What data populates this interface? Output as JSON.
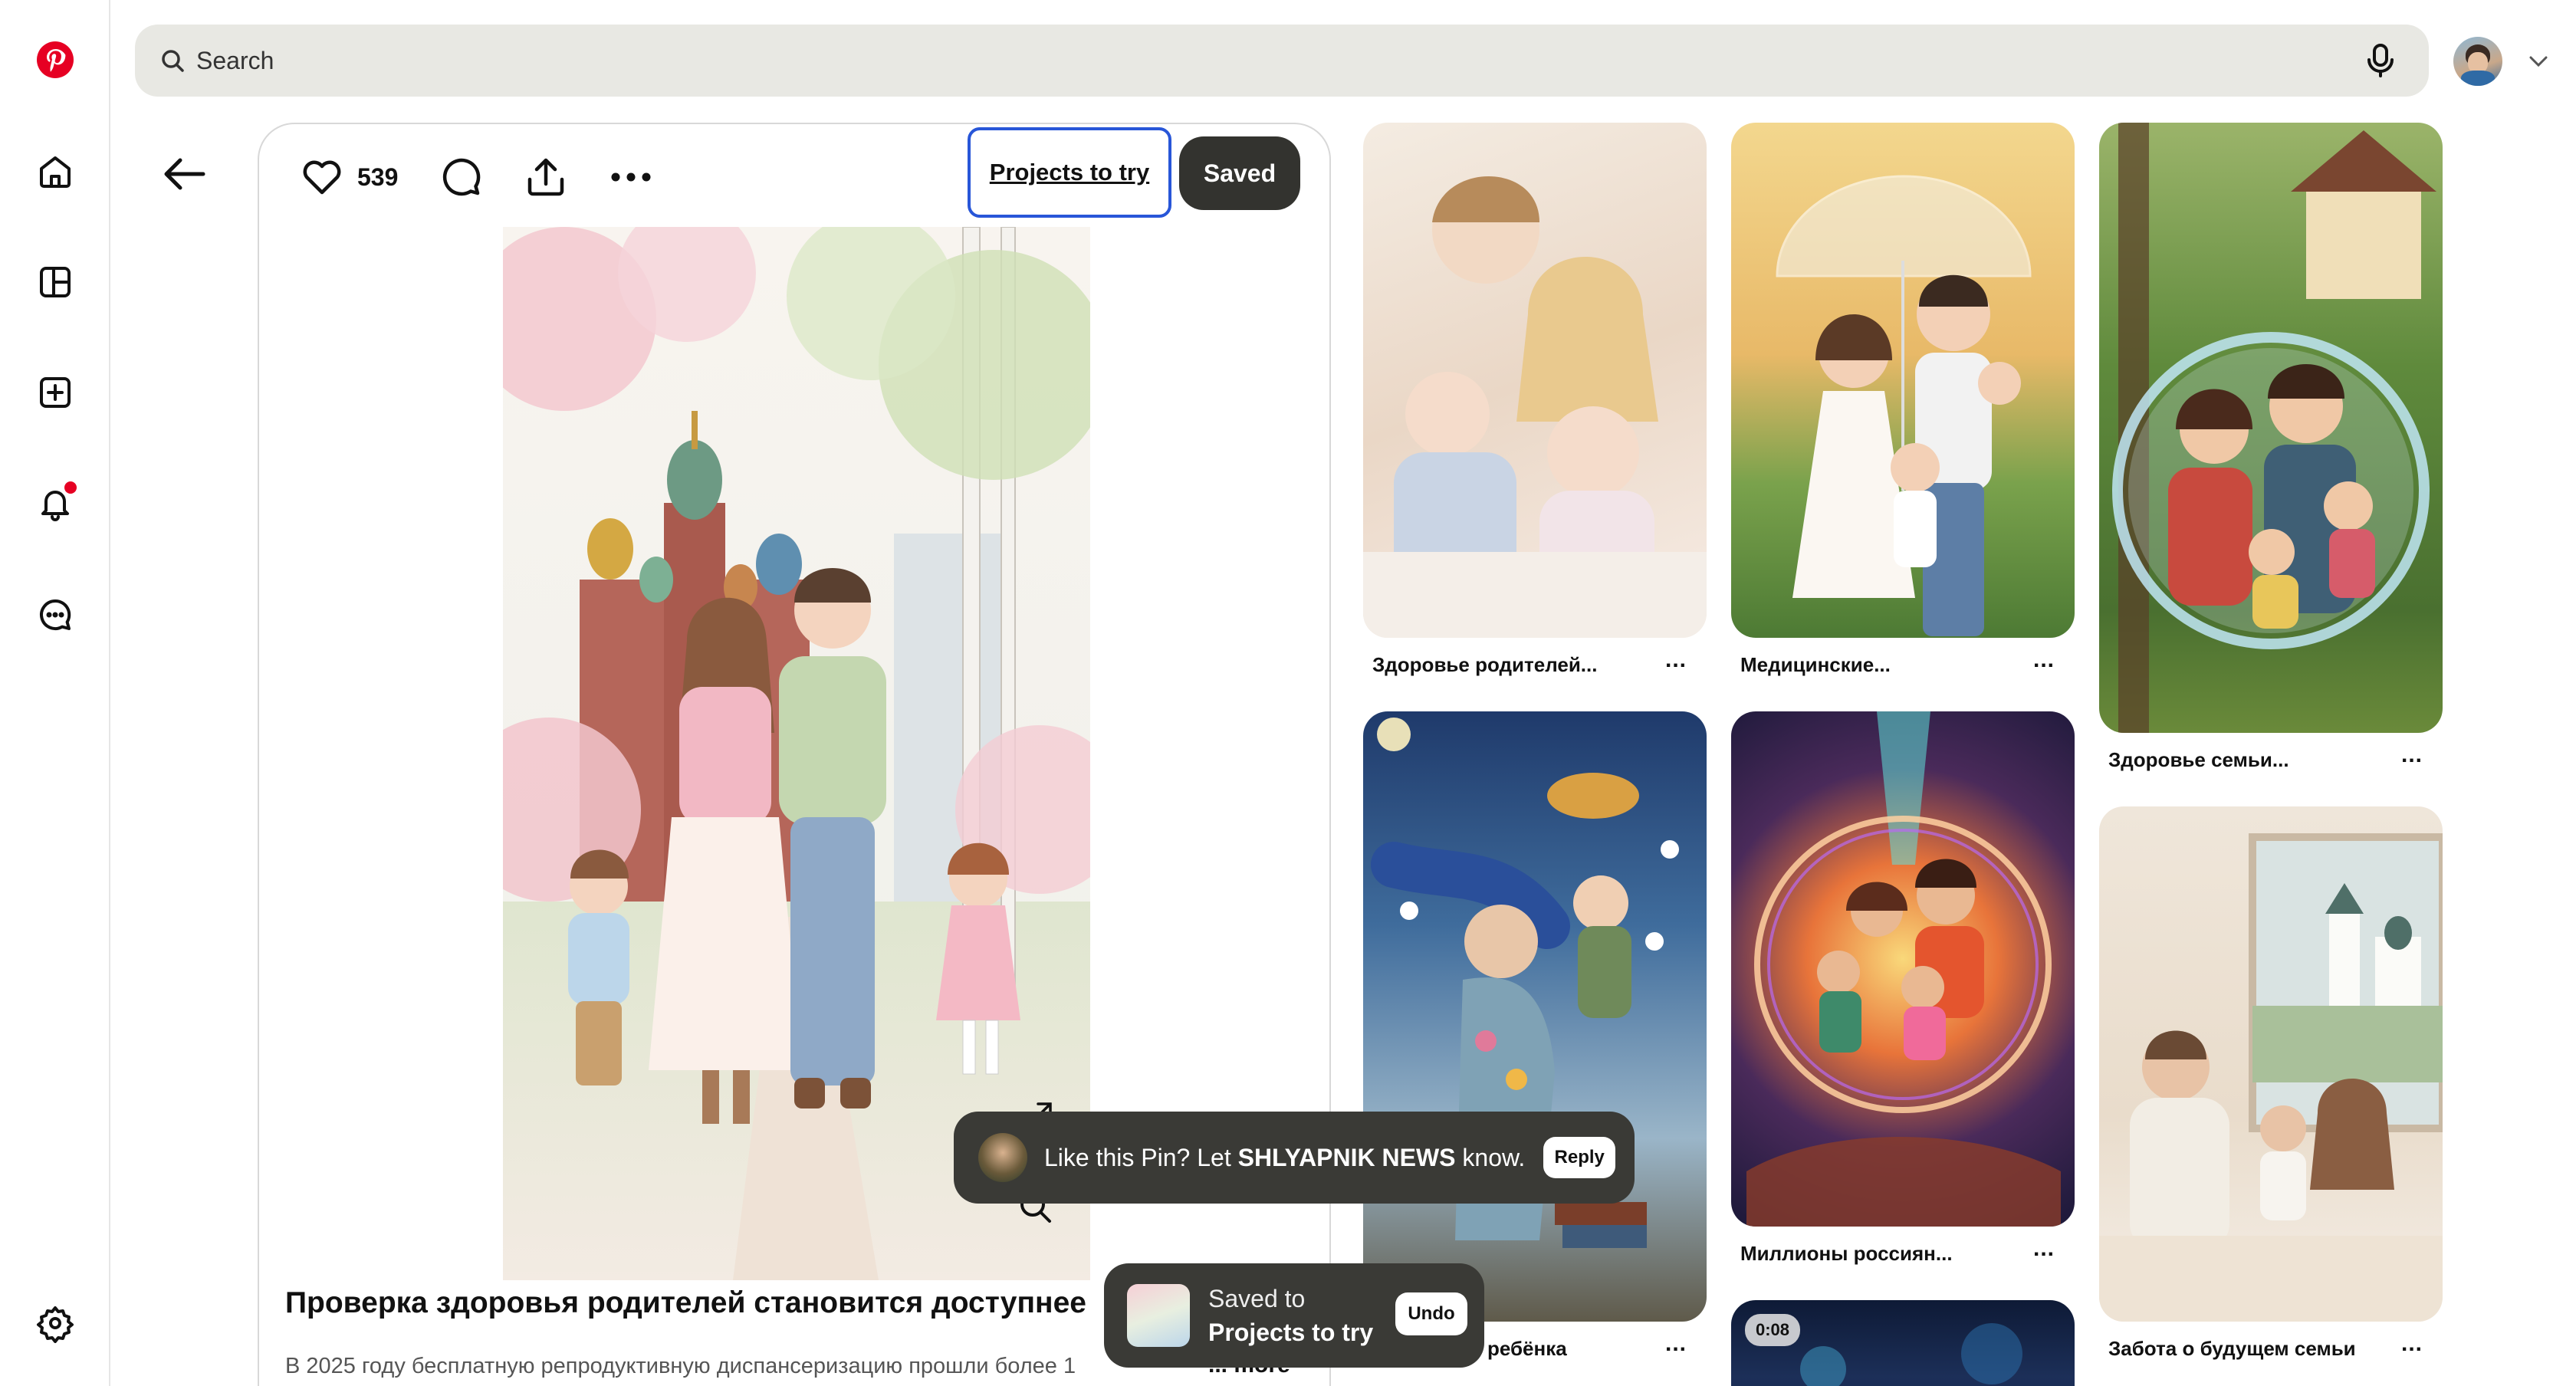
{
  "search": {
    "placeholder": "Search"
  },
  "pin": {
    "like_count": "539",
    "board_button": "Projects to try",
    "saved_button": "Saved",
    "title": "Проверка здоровья родителей становится доступнее",
    "description": "В 2025 году бесплатную репродуктивную диспансеризацию прошли более 1",
    "more_label": "... more"
  },
  "toast_like": {
    "text_prefix": "Like this Pin? Let ",
    "author": "SHLYAPNIK NEWS",
    "text_suffix": " know.",
    "reply_label": "Reply"
  },
  "toast_saved": {
    "line1": "Saved to",
    "line2": "Projects to try",
    "undo_label": "Undo"
  },
  "grid": [
    {
      "caption": "Здоровье родителей..."
    },
    {
      "caption": "Медицинские..."
    },
    {
      "caption": "Здоровье семьи..."
    },
    {
      "caption": "ребёнка"
    },
    {
      "caption": "Миллионы россиян..."
    },
    {
      "caption": "Забота о будущем семьи"
    },
    {
      "caption": "",
      "badge": "0:08"
    }
  ],
  "colors": {
    "brand": "#e60023",
    "accent": "#2856d8",
    "saved_bg": "#33332f"
  }
}
